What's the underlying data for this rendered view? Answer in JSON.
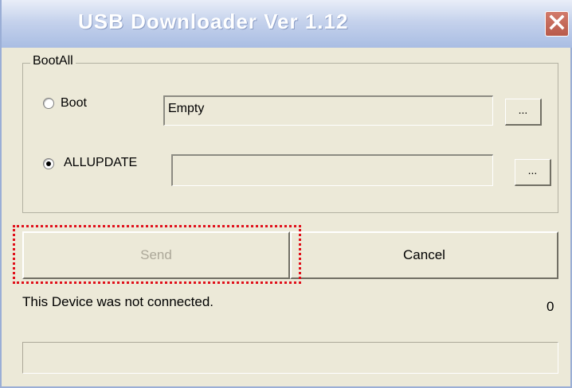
{
  "window": {
    "title": "USB Downloader Ver 1.12",
    "close_icon": "close-icon"
  },
  "bootall": {
    "legend": "BootAll",
    "boot": {
      "label": "Boot",
      "checked": false,
      "value": "Empty",
      "browse_label": "..."
    },
    "allupdate": {
      "label": "ALLUPDATE",
      "checked": true,
      "value": "",
      "browse_label": "..."
    }
  },
  "actions": {
    "send_label": "Send",
    "send_enabled": false,
    "cancel_label": "Cancel"
  },
  "status": {
    "message": "This Device was not connected.",
    "count": "0",
    "progress": 0
  },
  "colors": {
    "highlight": "#e0101a",
    "disabled_text": "#aca899"
  }
}
